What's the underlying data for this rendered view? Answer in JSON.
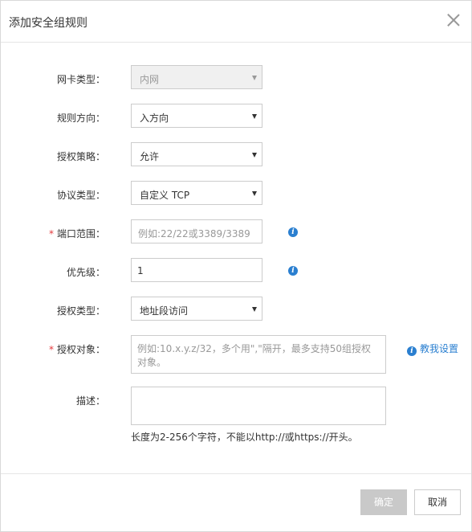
{
  "dialog": {
    "title": "添加安全组规则",
    "close_icon": "close-icon"
  },
  "fields": {
    "nic_type": {
      "label": "网卡类型：",
      "value": "内网",
      "disabled": true
    },
    "direction": {
      "label": "规则方向：",
      "value": "入方向"
    },
    "policy": {
      "label": "授权策略：",
      "value": "允许"
    },
    "protocol": {
      "label": "协议类型：",
      "value": "自定义 TCP"
    },
    "port_range": {
      "required_mark": "*",
      "label": "端口范围：",
      "placeholder": "例如:22/22或3389/3389"
    },
    "priority": {
      "label": "优先级：",
      "value": "1"
    },
    "auth_type": {
      "label": "授权类型：",
      "value": "地址段访问"
    },
    "auth_object": {
      "required_mark": "*",
      "label": "授权对象：",
      "placeholder": "例如:10.x.y.z/32，多个用\",\"隔开，最多支持50组授权对象。",
      "help_link": "教我设置"
    },
    "description": {
      "label": "描述：",
      "hint": "长度为2-256个字符，不能以http://或https://开头。"
    }
  },
  "buttons": {
    "ok": "确定",
    "cancel": "取消"
  },
  "colors": {
    "accent": "#2a7fd0",
    "required": "#e4393c",
    "disabled_button": "#c9c9c9"
  }
}
